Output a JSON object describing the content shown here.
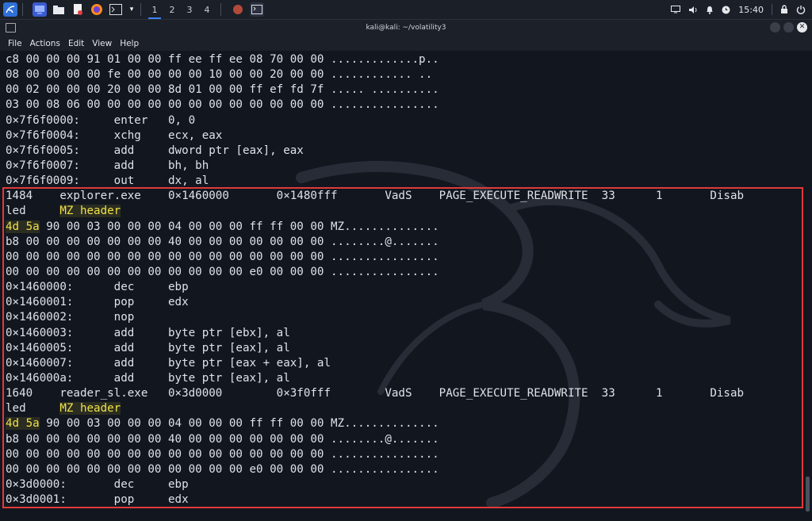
{
  "taskbar": {
    "workspaces": [
      "1",
      "2",
      "3",
      "4"
    ],
    "clock": "15:40"
  },
  "window": {
    "title": "kali@kali: ~/volatility3"
  },
  "menu": [
    "File",
    "Actions",
    "Edit",
    "View",
    "Help"
  ],
  "terminal_lines": [
    {
      "text": "c8 00 00 00 91 01 00 00 ff ee ff ee 08 70 00 00 .............p.."
    },
    {
      "text": "08 00 00 00 00 fe 00 00 00 00 10 00 00 20 00 00 ............ .."
    },
    {
      "text": "00 02 00 00 00 20 00 00 8d 01 00 00 ff ef fd 7f ..... .........."
    },
    {
      "text": "03 00 08 06 00 00 00 00 00 00 00 00 00 00 00 00 ................"
    },
    {
      "text": "0×7f6f0000:     enter   0, 0"
    },
    {
      "text": "0×7f6f0004:     xchg    ecx, eax"
    },
    {
      "text": "0×7f6f0005:     add     dword ptr [eax], eax"
    },
    {
      "text": "0×7f6f0007:     add     bh, bh"
    },
    {
      "text": "0×7f6f0009:     out     dx, al"
    },
    {
      "text": "1484    explorer.exe    0×1460000       0×1480fff       VadS    PAGE_EXECUTE_READWRITE  33      1       Disab"
    },
    {
      "text": "led     ",
      "highlight": "MZ header"
    },
    {
      "prefix_highlight": "4d 5a",
      "text": " 90 00 03 00 00 00 04 00 00 00 ff ff 00 00 MZ.............."
    },
    {
      "text": "b8 00 00 00 00 00 00 00 40 00 00 00 00 00 00 00 ........@......."
    },
    {
      "text": "00 00 00 00 00 00 00 00 00 00 00 00 00 00 00 00 ................"
    },
    {
      "text": "00 00 00 00 00 00 00 00 00 00 00 00 e0 00 00 00 ................"
    },
    {
      "text": "0×1460000:      dec     ebp"
    },
    {
      "text": "0×1460001:      pop     edx"
    },
    {
      "text": "0×1460002:      nop"
    },
    {
      "text": "0×1460003:      add     byte ptr [ebx], al"
    },
    {
      "text": "0×1460005:      add     byte ptr [eax], al"
    },
    {
      "text": "0×1460007:      add     byte ptr [eax + eax], al"
    },
    {
      "text": "0×146000a:      add     byte ptr [eax], al"
    },
    {
      "text": "1640    reader_sl.exe   0×3d0000        0×3f0fff        VadS    PAGE_EXECUTE_READWRITE  33      1       Disab"
    },
    {
      "text": "led     ",
      "highlight": "MZ header"
    },
    {
      "prefix_highlight": "4d 5a",
      "text": " 90 00 03 00 00 00 04 00 00 00 ff ff 00 00 MZ.............."
    },
    {
      "text": "b8 00 00 00 00 00 00 00 40 00 00 00 00 00 00 00 ........@......."
    },
    {
      "text": "00 00 00 00 00 00 00 00 00 00 00 00 00 00 00 00 ................"
    },
    {
      "text": "00 00 00 00 00 00 00 00 00 00 00 00 e0 00 00 00 ................"
    },
    {
      "text": "0×3d0000:       dec     ebp"
    },
    {
      "text": "0×3d0001:       pop     edx"
    }
  ],
  "colors": {
    "highlight_box": "#e03b3b",
    "highlight_text": "#f1e04a",
    "accent": "#3b82f6"
  }
}
